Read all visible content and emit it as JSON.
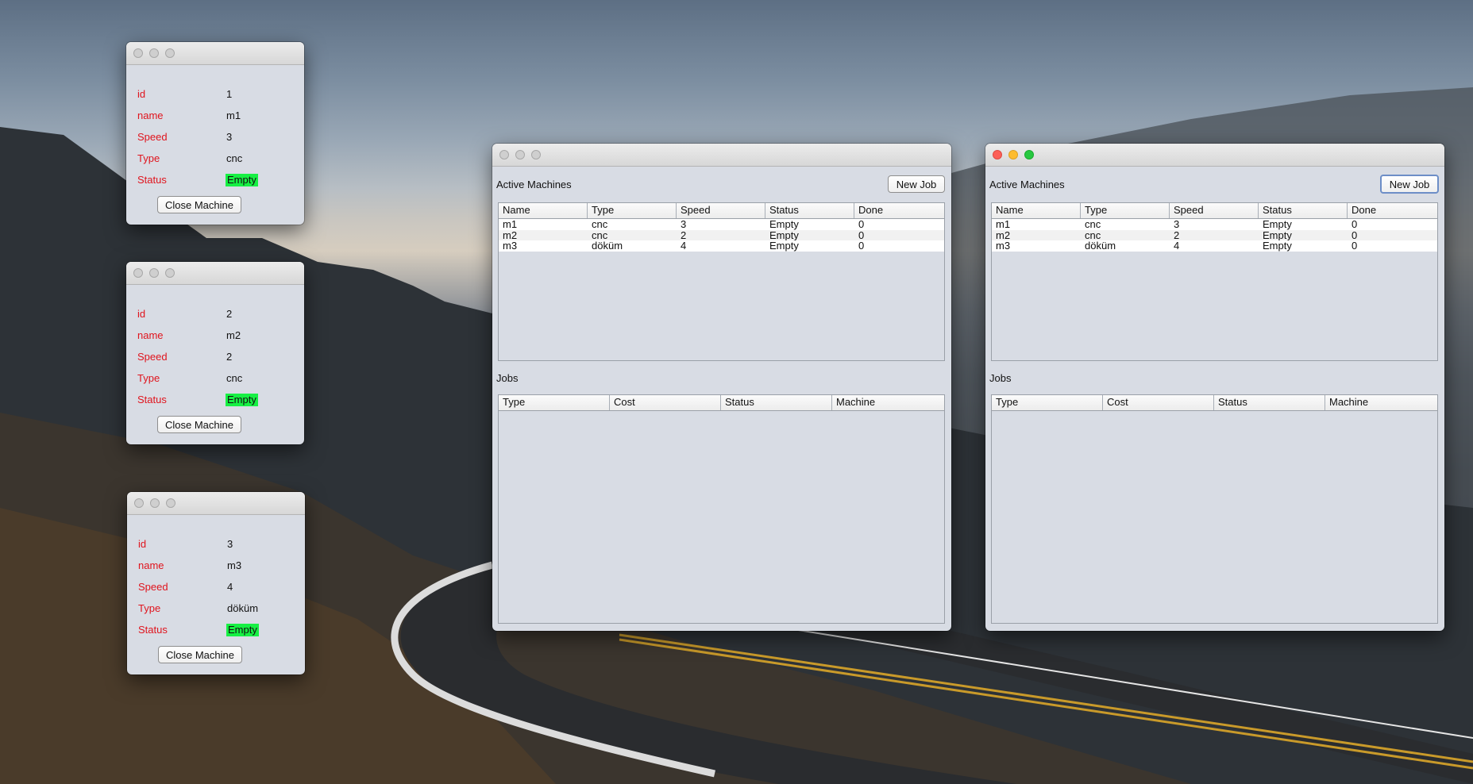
{
  "machine_windows": [
    {
      "fields": [
        {
          "label": "id",
          "value": "1"
        },
        {
          "label": "name",
          "value": "m1"
        },
        {
          "label": "Speed",
          "value": "3"
        },
        {
          "label": "Type",
          "value": "cnc"
        },
        {
          "label": "Status",
          "value": "Empty"
        }
      ],
      "close_label": "Close Machine"
    },
    {
      "fields": [
        {
          "label": "id",
          "value": "2"
        },
        {
          "label": "name",
          "value": "m2"
        },
        {
          "label": "Speed",
          "value": "2"
        },
        {
          "label": "Type",
          "value": "cnc"
        },
        {
          "label": "Status",
          "value": "Empty"
        }
      ],
      "close_label": "Close Machine"
    },
    {
      "fields": [
        {
          "label": "id",
          "value": "3"
        },
        {
          "label": "name",
          "value": "m3"
        },
        {
          "label": "Speed",
          "value": "4"
        },
        {
          "label": "Type",
          "value": "döküm"
        },
        {
          "label": "Status",
          "value": "Empty"
        }
      ],
      "close_label": "Close Machine"
    }
  ],
  "manager_windows": [
    {
      "active_label": "Active Machines",
      "new_job_label": "New Job",
      "machines_columns": [
        "Name",
        "Type",
        "Speed",
        "Status",
        "Done"
      ],
      "machines_rows": [
        [
          "m1",
          "cnc",
          "3",
          "Empty",
          "0"
        ],
        [
          "m2",
          "cnc",
          "2",
          "Empty",
          "0"
        ],
        [
          "m3",
          "döküm",
          "4",
          "Empty",
          "0"
        ]
      ],
      "jobs_label": "Jobs",
      "jobs_columns": [
        "Type",
        "Cost",
        "Status",
        "Machine"
      ]
    },
    {
      "active_label": "Active Machines",
      "new_job_label": "New Job",
      "machines_columns": [
        "Name",
        "Type",
        "Speed",
        "Status",
        "Done"
      ],
      "machines_rows": [
        [
          "m1",
          "cnc",
          "3",
          "Empty",
          "0"
        ],
        [
          "m2",
          "cnc",
          "2",
          "Empty",
          "0"
        ],
        [
          "m3",
          "döküm",
          "4",
          "Empty",
          "0"
        ]
      ],
      "jobs_label": "Jobs",
      "jobs_columns": [
        "Type",
        "Cost",
        "Status",
        "Machine"
      ]
    }
  ],
  "colors": {
    "field_label": "#e0141d",
    "status_highlight": "#16f043",
    "window_bg": "#d8dce4"
  }
}
